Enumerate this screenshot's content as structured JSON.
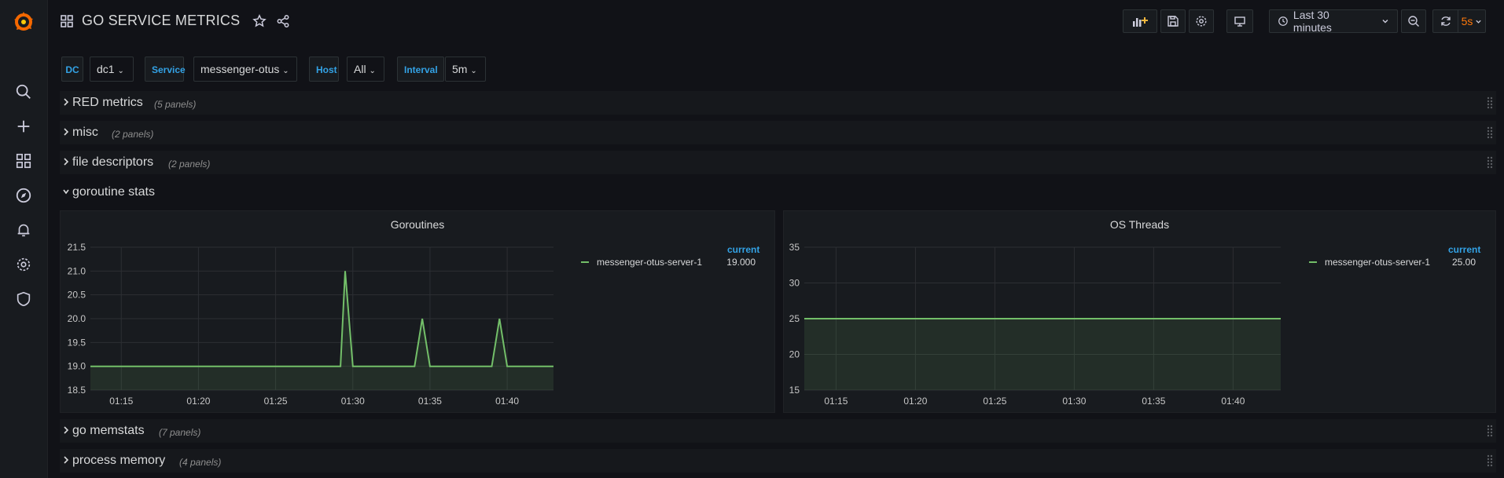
{
  "dashboard": {
    "title": "GO SERVICE METRICS"
  },
  "toolbar": {
    "time_range": "Last 30 minutes",
    "refresh_interval": "5s"
  },
  "variables": [
    {
      "label": "DC",
      "value": "dc1"
    },
    {
      "label": "Service",
      "value": "messenger-otus"
    },
    {
      "label": "Host",
      "value": "All"
    },
    {
      "label": "Interval",
      "value": "5m"
    }
  ],
  "rows": [
    {
      "title": "RED metrics",
      "count": "(5 panels)"
    },
    {
      "title": "misc",
      "count": "(2 panels)"
    },
    {
      "title": "file descriptors",
      "count": "(2 panels)"
    },
    {
      "title": "goroutine stats",
      "count": ""
    },
    {
      "title": "go memstats",
      "count": "(7 panels)"
    },
    {
      "title": "process memory",
      "count": "(4 panels)"
    }
  ],
  "colors": {
    "accent": "#33a2e5",
    "series": "#73bf69",
    "refresh": "#ff780a",
    "logo": "#f46800"
  },
  "icons": [
    "grafana-logo-icon",
    "search-icon",
    "plus-icon",
    "dashboards-icon",
    "explore-icon",
    "alerting-icon",
    "gear-icon",
    "shield-icon",
    "star-icon",
    "share-icon",
    "add-panel-icon",
    "save-icon",
    "settings-icon",
    "tv-icon",
    "clock-icon",
    "zoom-out-icon",
    "refresh-icon"
  ],
  "chart_data": [
    {
      "type": "area",
      "title": "Goroutines",
      "x": [
        "01:15",
        "01:20",
        "01:25",
        "01:30",
        "01:35",
        "01:40"
      ],
      "ylim": [
        18.5,
        21.5
      ],
      "yticks": [
        "18.5",
        "19.0",
        "19.5",
        "20.0",
        "20.5",
        "21.0",
        "21.5"
      ],
      "legend_header": "current",
      "series": [
        {
          "name": "messenger-otus-server-1",
          "current": "19.000",
          "points": [
            {
              "t": "01:13",
              "v": 19
            },
            {
              "t": "01:29.2",
              "v": 19
            },
            {
              "t": "01:29.5",
              "v": 21
            },
            {
              "t": "01:30",
              "v": 19
            },
            {
              "t": "01:34",
              "v": 19
            },
            {
              "t": "01:34.5",
              "v": 20
            },
            {
              "t": "01:35",
              "v": 19
            },
            {
              "t": "01:39",
              "v": 19
            },
            {
              "t": "01:39.5",
              "v": 20
            },
            {
              "t": "01:40",
              "v": 19
            },
            {
              "t": "01:43",
              "v": 19
            }
          ]
        }
      ]
    },
    {
      "type": "area",
      "title": "OS Threads",
      "x": [
        "01:15",
        "01:20",
        "01:25",
        "01:30",
        "01:35",
        "01:40"
      ],
      "ylim": [
        15,
        35
      ],
      "yticks": [
        "15",
        "20",
        "25",
        "30",
        "35"
      ],
      "legend_header": "current",
      "series": [
        {
          "name": "messenger-otus-server-1",
          "current": "25.00",
          "points": [
            {
              "t": "01:13",
              "v": 25
            },
            {
              "t": "01:43",
              "v": 25
            }
          ]
        }
      ]
    }
  ]
}
